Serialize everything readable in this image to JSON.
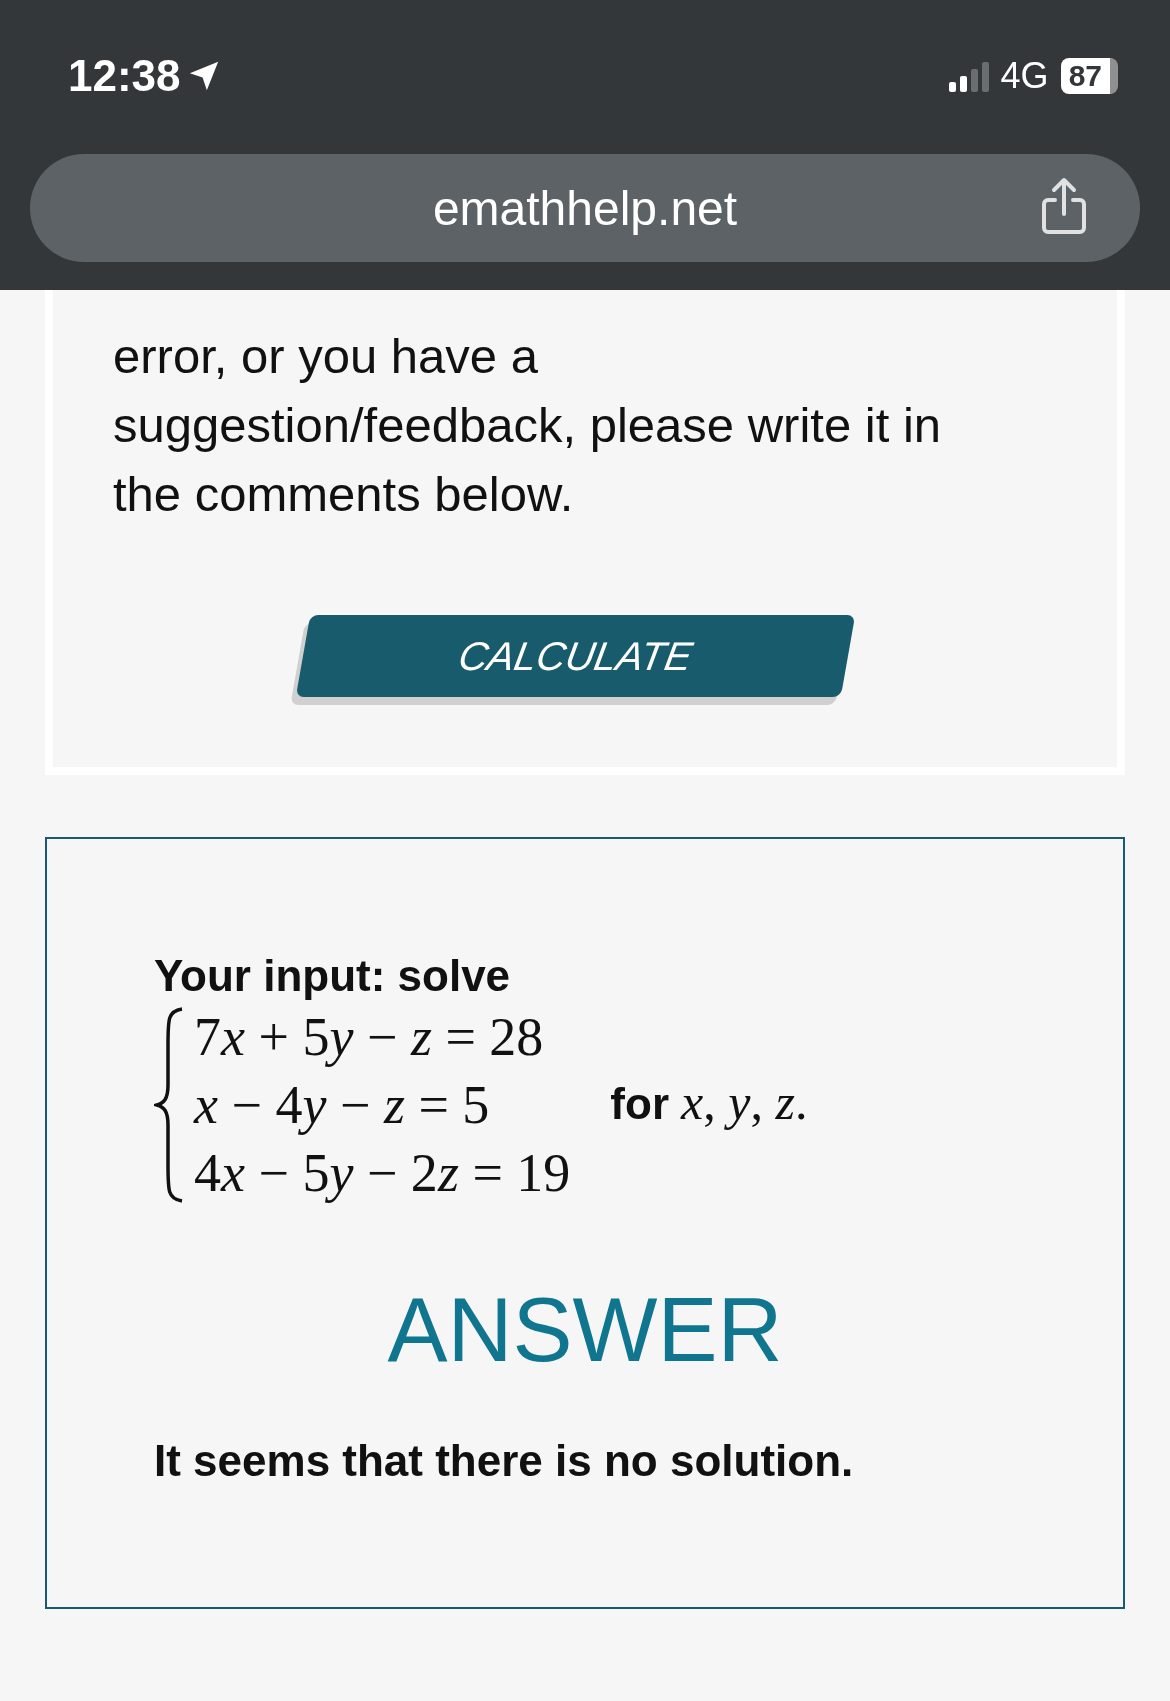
{
  "status_bar": {
    "time": "12:38",
    "network": "4G",
    "battery": "87"
  },
  "address_bar": {
    "url": "emathhelp.net"
  },
  "notice": {
    "text": "error, or you have a suggestion/feedback, please write it in the comments below."
  },
  "calculate_button": {
    "label": "CALCULATE"
  },
  "result": {
    "input_label": "Your input: solve",
    "equations": [
      [
        {
          "kind": "num",
          "text": "7"
        },
        {
          "kind": "var",
          "text": "x"
        },
        {
          "kind": "num",
          "text": " + 5"
        },
        {
          "kind": "var",
          "text": "y"
        },
        {
          "kind": "num",
          "text": " − "
        },
        {
          "kind": "var",
          "text": "z"
        },
        {
          "kind": "num",
          "text": " = 28"
        }
      ],
      [
        {
          "kind": "var",
          "text": "x"
        },
        {
          "kind": "num",
          "text": " − 4"
        },
        {
          "kind": "var",
          "text": "y"
        },
        {
          "kind": "num",
          "text": " − "
        },
        {
          "kind": "var",
          "text": "z"
        },
        {
          "kind": "num",
          "text": " = 5"
        }
      ],
      [
        {
          "kind": "num",
          "text": "4"
        },
        {
          "kind": "var",
          "text": "x"
        },
        {
          "kind": "num",
          "text": " − 5"
        },
        {
          "kind": "var",
          "text": "y"
        },
        {
          "kind": "num",
          "text": " − 2"
        },
        {
          "kind": "var",
          "text": "z"
        },
        {
          "kind": "num",
          "text": " = 19"
        }
      ]
    ],
    "for_label": "for",
    "variables": "*x*, *y*, *z*.",
    "answer_heading": "ANSWER",
    "answer_text": "It seems that there is no solution."
  }
}
